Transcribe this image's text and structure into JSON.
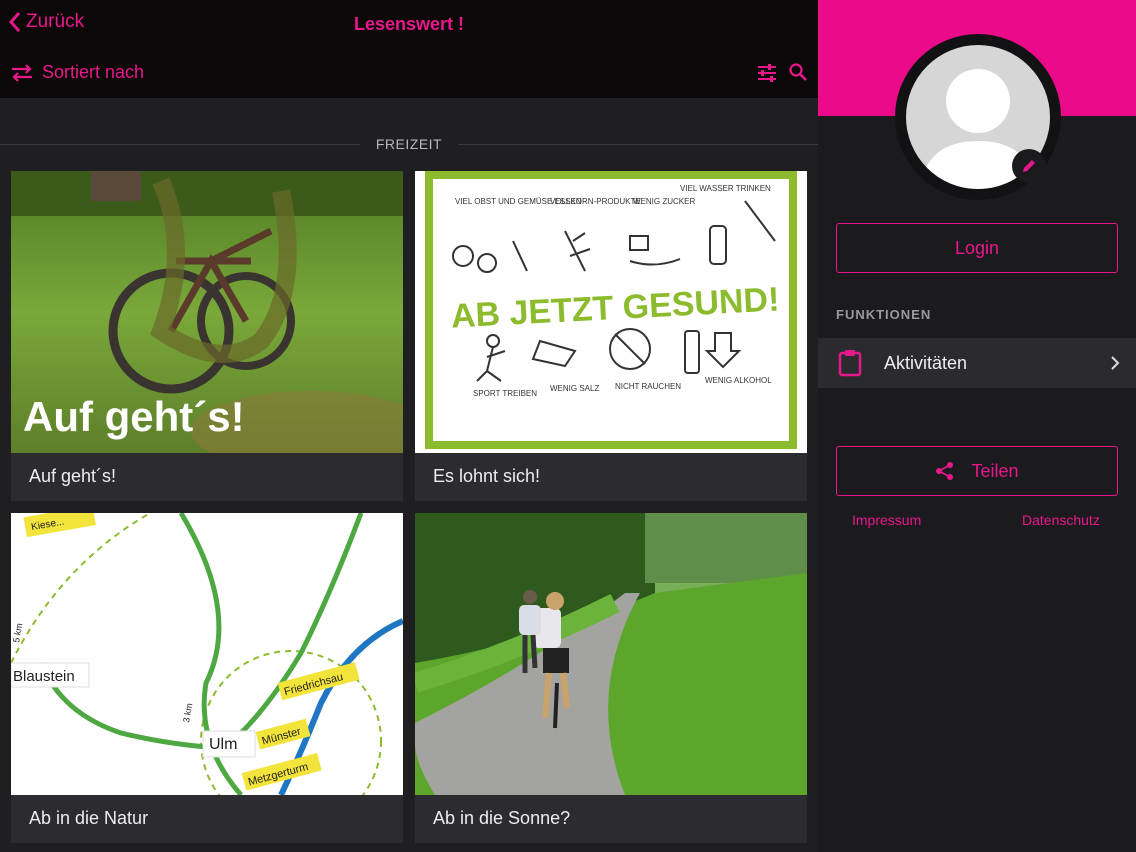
{
  "header": {
    "back_label": "Zurück",
    "title": "Lesenswert !",
    "sort_label": "Sortiert nach"
  },
  "section": {
    "label": "FREIZEIT"
  },
  "cards": [
    {
      "caption": "Auf geht´s!",
      "overlay_text": "Auf geht´s!"
    },
    {
      "caption": "Es lohnt sich!",
      "poster": {
        "headline": "AB JETZT GESUND!",
        "top": [
          "VIEL OBST UND GEMÜSE ESSEN",
          "VOLLKORN-PRODUKTE",
          "WENIG ZUCKER",
          "VIEL WASSER TRINKEN"
        ],
        "bottom": [
          "SPORT TREIBEN",
          "WENIG SALZ",
          "NICHT RAUCHEN",
          "WENIG ALKOHOL"
        ]
      }
    },
    {
      "caption": "Ab in die Natur",
      "map": {
        "labels": [
          "Blaustein",
          "Ulm",
          "Friedrichsau",
          "Münster",
          "Metzgerturm",
          "Kiese...",
          "3 km",
          "5 km"
        ]
      }
    },
    {
      "caption": "Ab in die Sonne?"
    }
  ],
  "sidebar": {
    "login_label": "Login",
    "functions_label": "FUNKTIONEN",
    "activities_label": "Aktivitäten",
    "share_label": "Teilen",
    "impressum_label": "Impressum",
    "datenschutz_label": "Datenschutz"
  },
  "colors": {
    "accent": "#e8188a",
    "header_pink": "#ea0a8a",
    "background": "#1f1f22"
  }
}
